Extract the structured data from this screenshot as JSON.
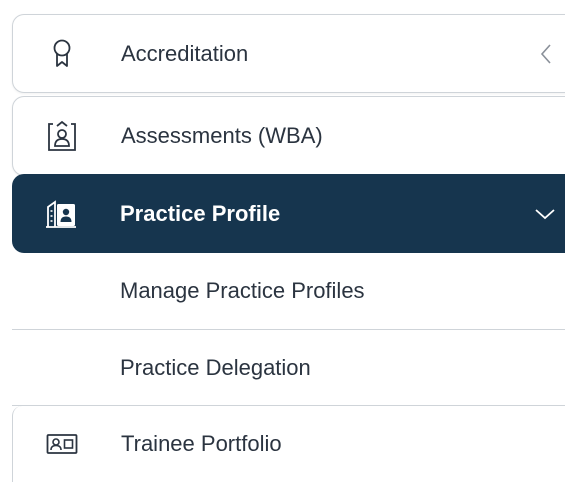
{
  "nav": {
    "items": [
      {
        "label": "Accreditation",
        "icon": "ribbon-icon",
        "state": "collapsed"
      },
      {
        "label": "Assessments (WBA)",
        "icon": "clipboard-user-icon"
      },
      {
        "label": "Practice Profile",
        "icon": "building-profile-icon",
        "state": "expanded",
        "children": [
          {
            "label": "Manage Practice Profiles"
          },
          {
            "label": "Practice Delegation"
          }
        ]
      },
      {
        "label": "Trainee Portfolio",
        "icon": "id-card-icon"
      }
    ]
  },
  "colors": {
    "active_bg": "#16354e",
    "active_text": "#ffffff",
    "text": "#2b3440",
    "border": "#cfd4d9"
  }
}
